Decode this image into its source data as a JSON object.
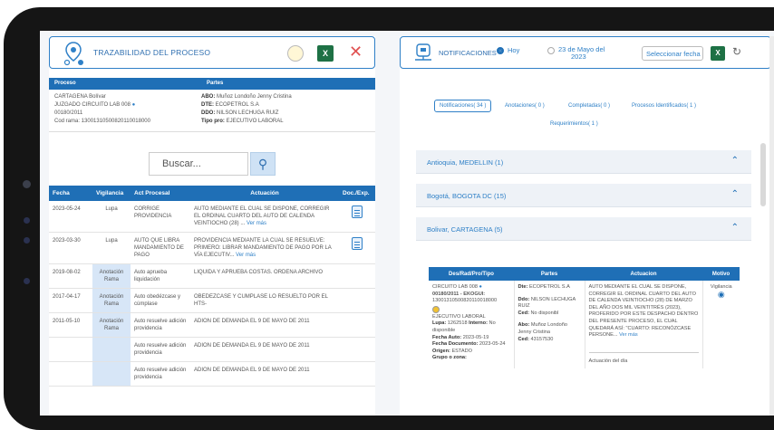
{
  "left": {
    "title": "TRAZABILIDAD DEL PROCESO",
    "close": "✕",
    "xls": "X",
    "proceso_header": "Proceso",
    "partes_header": "Partes",
    "proceso": {
      "line1": "CARTAGENA Bolívar",
      "line2": "JUZGADO CIRCUITO LAB 008",
      "line3": "00180/2011",
      "line4": "Cod rama: 13001310500820110018000"
    },
    "partes": [
      {
        "k": "ABO:",
        "v": "Muñoz Londoño Jenny Cristina"
      },
      {
        "k": "DTE:",
        "v": "ECOPETROL S.A"
      },
      {
        "k": "DDO:",
        "v": "NILSON LECHUGA RUIZ"
      },
      {
        "k": "Tipo pro:",
        "v": "EJECUTIVO LABORAL"
      }
    ],
    "search_placeholder": "Buscar...",
    "columns": [
      "Fecha",
      "Vigilancia",
      "Act Procesal",
      "Actuación",
      "Doc./Exp."
    ],
    "rows": [
      {
        "fecha": "2023-05-24",
        "vig": "Lupa",
        "act": "CORRIGE PROVIDENCIA",
        "actuacion": "AUTO MEDIANTE EL CUAL SE DISPONE, CORREGIR EL ORDINAL CUARTO DEL AUTO DE CALENDA VEINTIOCHO (28) ...",
        "more": "Ver más",
        "doc": true
      },
      {
        "fecha": "2023-03-30",
        "vig": "Lupa",
        "act": "AUTO QUE LIBRA MANDAMIENTO DE PAGO",
        "actuacion": "PROVIDENCIA MEDIANTE LA CUAL SE RESUELVE: PRIMERO: LIBRAR MANDAMIENTO DE PAGO POR LA VÍA EJECUTIV...",
        "more": "Ver más",
        "doc": true
      },
      {
        "fecha": "2019-08-02",
        "vig": "Anotación Rama",
        "act": "Auto aprueba liquidación",
        "actuacion": "LIQUIDA Y APRUEBA COSTAS. ORDENA ARCHIVO",
        "more": "",
        "doc": false
      },
      {
        "fecha": "2017-04-17",
        "vig": "Anotación Rama",
        "act": "Auto obedézcase y cúmplase",
        "actuacion": "OBEDEZCASE Y CUMPLASE LO RESUELTO POR EL HTS-",
        "more": "",
        "doc": false
      },
      {
        "fecha": "2011-05-10",
        "vig": "Anotación Rama",
        "act": "Auto resuelve adición providencia",
        "actuacion": "ADION DE DEMANDA EL 9 DE MAYO DE 2011",
        "more": "",
        "doc": false
      },
      {
        "fecha": "",
        "vig": "",
        "act": "Auto resuelve adición providencia",
        "actuacion": "ADION DE DEMANDA EL 9 DE MAYO DE 2011",
        "more": "",
        "doc": false
      },
      {
        "fecha": "",
        "vig": "",
        "act": "Auto resuelve adición providencia",
        "actuacion": "ADION DE DEMANDA EL 9 DE MAYO DE 2011",
        "more": "",
        "doc": false
      }
    ]
  },
  "right": {
    "title": "NOTIFICACIONES",
    "radio_hoy": "Hoy",
    "radio_date_1": "23 de Mayo del",
    "radio_date_2": "2023",
    "select_date": "Seleccionar fecha",
    "xls": "X",
    "refresh": "↻",
    "tabs": [
      "Notificaciones( 34 )",
      "Anotaciones( 0 )",
      "Completadas( 0 )",
      "Procesos Identificados( 1 )",
      "Requerimientos( 1 )"
    ],
    "accordions": [
      "Antioquia, MEDELLIN (1)",
      "Bogotá, BOGOTA DC (15)",
      "Bolivar, CARTAGENA (5)"
    ],
    "columns": [
      "Des/Rad/Pro/Tipo",
      "Partes",
      "Actuacion",
      "Motivo"
    ],
    "row": {
      "c1_line1": "CIRCUITO LAB 008",
      "c1_line2": "00180/2011 - EKOGUI:",
      "c1_line3": "13001310500820110018000",
      "c1_line4": "EJECUTIVO LABORAL",
      "c1_lupa_k": "Lupa:",
      "c1_lupa_v": "1262518",
      "c1_interno_k": "Interno:",
      "c1_interno_v": "No disponible",
      "c1_fa_k": "Fecha Auto:",
      "c1_fa_v": "2023-05-19",
      "c1_fd_k": "Fecha Documento:",
      "c1_fd_v": "2023-05-24",
      "c1_or_k": "Origen:",
      "c1_or_v": "ESTADO",
      "c1_gz_k": "Grupo o zona:",
      "c2_dte_k": "Dte:",
      "c2_dte_v": "ECOPETROL S.A",
      "c2_ddo_k": "Ddo:",
      "c2_ddo_v": "NILSON LECHUGA RUIZ",
      "c2_ced1_k": "Ced:",
      "c2_ced1_v": "No disponibl",
      "c2_abo_k": "Abo:",
      "c2_abo_v": "Muñoz Londoño Jenny Cristina",
      "c2_ced2_k": "Ced:",
      "c2_ced2_v": "43157530",
      "c3_text": "AUTO MEDIANTE EL CUAL SE DISPONE, CORREGIR EL ORDINAL CUARTO DEL AUTO DE CALENDA VEINTIOCHO (28) DE MARZO DEL AÑO DOS MIL VEINTITRÉS (2023), PROFERIDO POR ESTE DESPACHO DENTRO DEL PRESENTE PROCESO, EL CUAL QUEDARÁ ASÍ: \"CUARTO: RECONÓZCASE PERSONE...",
      "c3_more": "Ver más",
      "c3_actdia": "Actuación del día",
      "c4_motivo": "Vigilancia"
    }
  }
}
